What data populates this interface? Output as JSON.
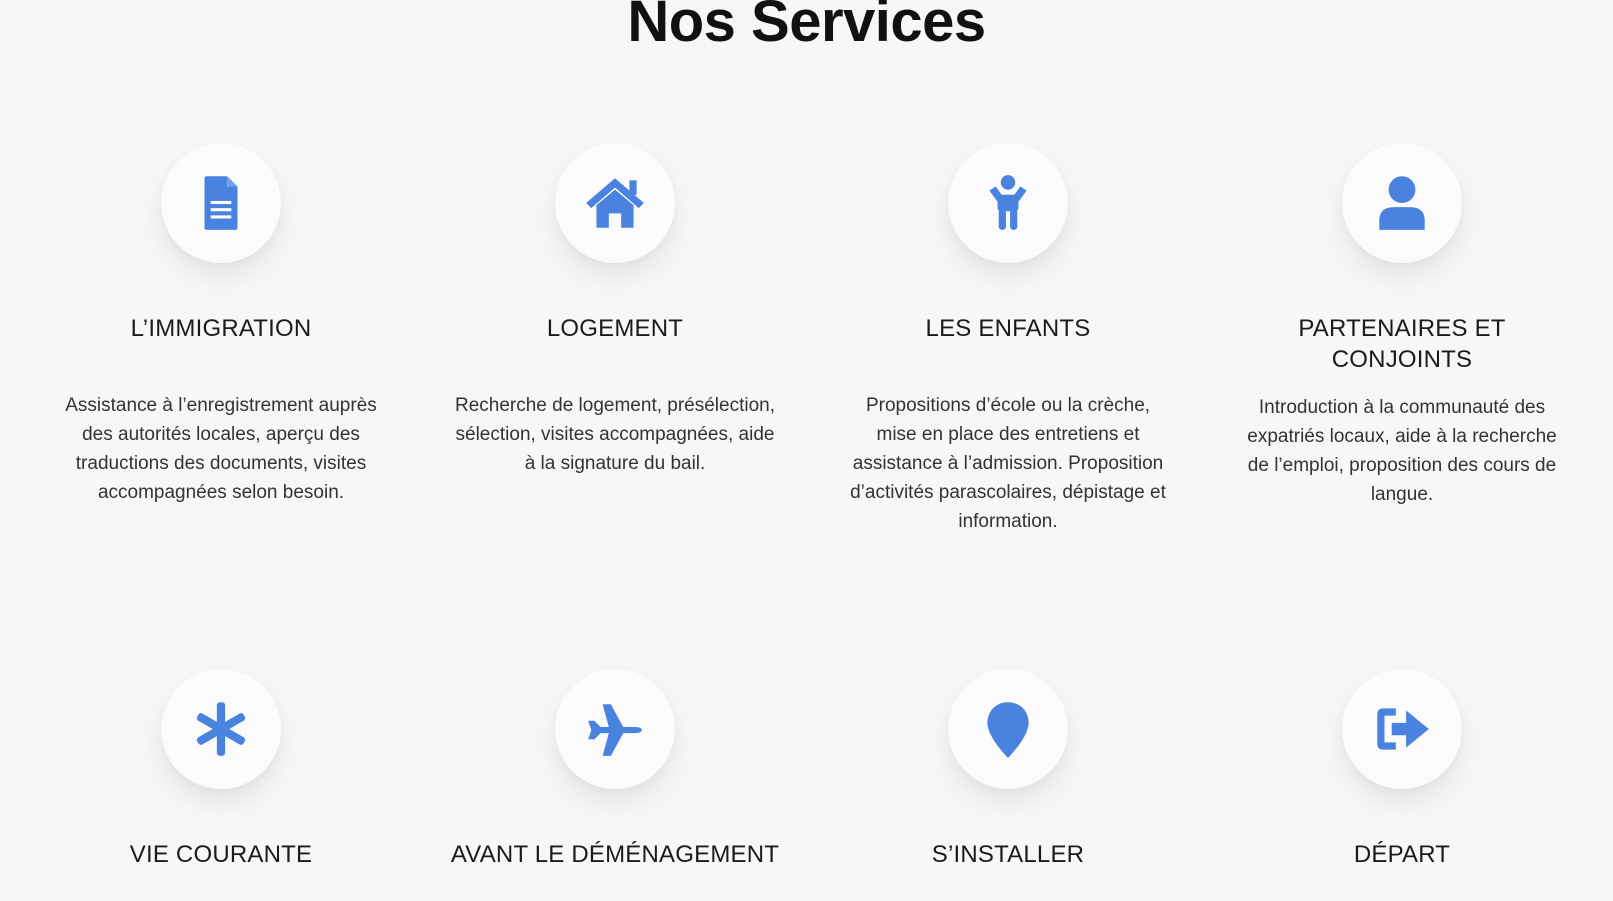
{
  "page": {
    "title": "Nos Services",
    "accent_color": "#4a82e0",
    "background_color": "#f7f7f8"
  },
  "services": [
    {
      "icon": "document-icon",
      "title": "L’IMMIGRATION",
      "description": "Assistance à l’enregistrement auprès des autorités locales, aperçu des traductions des documents, visites accompagnées selon besoin."
    },
    {
      "icon": "home-icon",
      "title": "LOGEMENT",
      "description": "Recherche de logement, présélection, sélection, visites accompagnées, aide à la signature du bail."
    },
    {
      "icon": "child-icon",
      "title": "LES ENFANTS",
      "description": "Propositions d’école ou la crèche, mise en place des entretiens et assistance à l’admission. Proposition d’activités parascolaires, dépistage et information."
    },
    {
      "icon": "user-icon",
      "title": "PARTENAIRES ET CONJOINTS",
      "description": "Introduction à la communauté des expatriés locaux, aide à la recherche de l’emploi, proposition des cours de langue."
    },
    {
      "icon": "asterisk-icon",
      "title": "VIE COURANTE",
      "description": ""
    },
    {
      "icon": "plane-icon",
      "title": "AVANT LE DÉMÉNAGEMENT",
      "description": ""
    },
    {
      "icon": "map-marker-icon",
      "title": "S’INSTALLER",
      "description": ""
    },
    {
      "icon": "sign-out-icon",
      "title": "DÉPART",
      "description": ""
    }
  ]
}
